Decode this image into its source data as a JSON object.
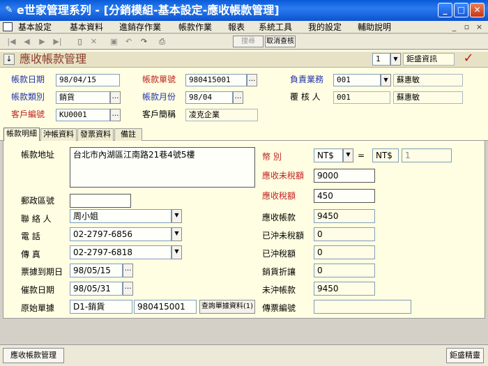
{
  "window": {
    "title": "e世家管理系列 - [分銷模組-基本設定-應收帳款管理]",
    "app_icon": "pen-icon",
    "controls": [
      "minimize-icon",
      "maximize-icon",
      "close-icon"
    ]
  },
  "menu": {
    "items": [
      "基本設定",
      "基本資料",
      "進銷存作業",
      "帳款作業",
      "報表",
      "系統工具",
      "我的設定",
      "輔助說明"
    ],
    "mdi_controls": [
      "_",
      "▫",
      "×"
    ]
  },
  "toolbar": {
    "find_label": "搜尋",
    "cancel_query_label": "取消查核"
  },
  "header": {
    "module_title": "應收帳款管理",
    "company_index": "1",
    "company_name": "鉅盛資訊"
  },
  "form": {
    "voucher_date_label": "帳款日期",
    "voucher_date": "98/04/15",
    "voucher_no_label": "帳款單號",
    "voucher_no": "980415001",
    "sales_label": "負責業務",
    "sales_code": "001",
    "sales_name": "蘇惠敏",
    "voucher_type_label": "帳款類別",
    "voucher_type": "銷貨",
    "voucher_month_label": "帳款月份",
    "voucher_month": "98/04",
    "reviewer_label": "覆 核 人",
    "reviewer_code": "001",
    "reviewer_name": "蘇惠敏",
    "customer_no_label": "客戶編號",
    "customer_no": "KU0001",
    "customer_abbr_label": "客戶簡稱",
    "customer_abbr": "凌克企業"
  },
  "tabs": [
    "帳款明細",
    "沖帳資料",
    "發票資料",
    "備註"
  ],
  "detail": {
    "address_label": "帳款地址",
    "address": "台北市內湖區江南路21巷4號5樓",
    "zip_label": "郵政區號",
    "zip": "",
    "contact_label": "聯 絡 人",
    "contact": "周小姐",
    "phone_label": "電    話",
    "phone": "02-2797-6856",
    "fax_label": "傳    真",
    "fax": "02-2797-6818",
    "due_date_label": "票據到期日",
    "due_date": "98/05/15",
    "collect_date_label": "催款日期",
    "collect_date": "98/05/31",
    "origin_label": "原始單據",
    "origin_type": "D1-銷貨",
    "origin_no": "980415001",
    "query_btn": "查詢單據資料(1)",
    "currency_label": "幣    別",
    "currency": "NT$",
    "equals": "=",
    "base_currency": "NT$",
    "rate": "1",
    "untaxed_label": "應收未稅額",
    "untaxed": "9000",
    "tax_label": "應收稅額",
    "tax": "450",
    "receivable_label": "應收帳款",
    "receivable": "9450",
    "offset_untaxed_label": "已沖未稅額",
    "offset_untaxed": "0",
    "offset_tax_label": "已沖稅額",
    "offset_tax": "0",
    "discount_label": "銷貨折讓",
    "discount": "0",
    "unoffset_label": "未沖帳款",
    "unoffset": "9450",
    "invoice_no_label": "傳票編號",
    "invoice_no": ""
  },
  "status": {
    "left": "應收帳款管理",
    "right": "鉅盛精靈"
  }
}
